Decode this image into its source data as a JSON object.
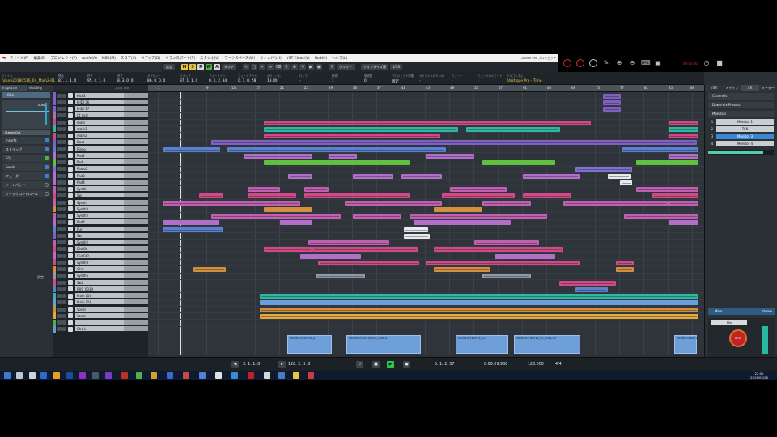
{
  "app": {
    "window_title": "Cubase Pro プロジェクト - future20180526"
  },
  "menu": [
    "ファイル(F)",
    "編集(E)",
    "プロジェクト(P)",
    "Audio(A)",
    "MIDI(M)",
    "スコア(S)",
    "メディア(D)",
    "トランスポート(T)",
    "スタジオ(U)",
    "ワークスペース(W)",
    "ウィンドウ(I)",
    "VST Cloud(V)",
    "Hub(H)",
    "ヘルプ(L)"
  ],
  "toolbar": {
    "setting_label": "設定",
    "m": "M",
    "s": "S",
    "r": "R",
    "w": "W",
    "a": "A",
    "touch_label": "タッチ",
    "grid_label": "グリッド",
    "quantize_mode": "クオンタイズ値",
    "quantize_value": "1/16"
  },
  "recorder": {
    "time": "00:00:00"
  },
  "infoline": {
    "fields": [
      {
        "label": "ファイル",
        "value": "future20180516_04_Main2-01",
        "highlight": true
      },
      {
        "label": "開始",
        "value": "87. 1. 1. 0"
      },
      {
        "label": "終了",
        "value": "95. 4. 1. 0"
      },
      {
        "label": "長さ",
        "value": "8. 3. 0. 0"
      },
      {
        "label": "オフセット",
        "value": "86. 0. 0. 0"
      },
      {
        "label": "スナップ",
        "value": "87. 1. 1. 0"
      },
      {
        "label": "フェードイン",
        "value": "0. 1. 2. 34"
      },
      {
        "label": "フェードアウト",
        "value": "0. 1. 0. 58"
      },
      {
        "label": "ボリューム",
        "value": "13.80"
      },
      {
        "label": "ロック",
        "value": "-"
      },
      {
        "label": "移調",
        "value": "1"
      },
      {
        "label": "微調整",
        "value": "0"
      },
      {
        "label": "プロジェクト同期",
        "value": "固定"
      },
      {
        "label": "オリジナルのテンポ",
        "value": "-"
      },
      {
        "label": "ミュート",
        "value": "-"
      },
      {
        "label": "ミュージカルモード",
        "value": "-"
      },
      {
        "label": "アルゴリズム",
        "value": "élastique Pro - Time",
        "highlight": true
      }
    ]
  },
  "inspector": {
    "tabs": [
      "Inspector",
      "Visibility"
    ],
    "track_name": "Cho",
    "output": "Stereo Out",
    "fader_value": "0.00",
    "sections": [
      {
        "label": "Inserts",
        "icon": "blue"
      },
      {
        "label": "ストリップ",
        "icon": "blue"
      },
      {
        "label": "EQ",
        "icon": "green"
      },
      {
        "label": "Sends",
        "icon": "blue"
      },
      {
        "label": "フェーダー",
        "icon": "blue"
      },
      {
        "label": "ノートパッド",
        "icon": "none"
      },
      {
        "label": "クイックコントロール",
        "icon": "none"
      }
    ],
    "setting_label": "設定",
    "bottom_tabs": [
      "トラック",
      "エディター"
    ]
  },
  "tracklist": {
    "header_numbers": "100 | 150",
    "tracks": [
      {
        "name": "Kick2",
        "color": "#8060c0"
      },
      {
        "name": "MIDI 36",
        "color": "#8060c0"
      },
      {
        "name": "MIDI 37",
        "color": "#8060c0"
      },
      {
        "name": "Ct noiz",
        "color": "#b070b0"
      },
      {
        "name": "main",
        "color": "#d04a88"
      },
      {
        "name": "main3",
        "color": "#30b8a0"
      },
      {
        "name": "main2",
        "color": "#d04a88"
      },
      {
        "name": "Bass",
        "color": "#8060c0"
      },
      {
        "name": "Piano",
        "color": "#5a80d0"
      },
      {
        "name": "Pad2",
        "color": "#b070c8"
      },
      {
        "name": "Pad",
        "color": "#60c040"
      },
      {
        "name": "Piano2",
        "color": "#8070d0"
      },
      {
        "name": "Pad3",
        "color": "#b070c8"
      },
      {
        "name": "Pad4",
        "color": "#b070c8"
      },
      {
        "name": "Synth",
        "color": "#c060b0"
      },
      {
        "name": "Sw",
        "color": "#d04a88"
      },
      {
        "name": "Synth",
        "color": "#c060b0"
      },
      {
        "name": "Synth3",
        "color": "#d09040"
      },
      {
        "name": "Synth2",
        "color": "#c060b0"
      },
      {
        "name": "Pad4",
        "color": "#b070c8"
      },
      {
        "name": "Pur",
        "color": "#5a80d0"
      },
      {
        "name": "Sw",
        "color": "#8060c0"
      },
      {
        "name": "Synth2",
        "color": "#c060b0"
      },
      {
        "name": "DistGt",
        "color": "#d04a88"
      },
      {
        "name": "DistGt2",
        "color": "#b070c8"
      },
      {
        "name": "Synth3",
        "color": "#d04a88"
      },
      {
        "name": "Ohit",
        "color": "#d09040"
      },
      {
        "name": "Synth5",
        "color": "#8e9aa6"
      },
      {
        "name": "Sw2",
        "color": "#d04a88"
      },
      {
        "name": "R09_0034",
        "color": "#5a80d0"
      },
      {
        "name": "Main (D)",
        "color": "#30b8a0"
      },
      {
        "name": "Main (D)",
        "color": "#6aa0e0"
      },
      {
        "name": "Vocal",
        "color": "#d09040"
      },
      {
        "name": "Vocal",
        "color": "#e4a840"
      },
      {
        "name": "",
        "color": "#4fb04f"
      },
      {
        "name": "Cho L",
        "color": "#6a9ad0"
      }
    ]
  },
  "ruler": {
    "bars": [
      "1",
      "9",
      "13",
      "17",
      "21",
      "25",
      "29",
      "33",
      "37",
      "41",
      "45",
      "49",
      "53",
      "57",
      "61",
      "65",
      "69",
      "73",
      "77",
      "81",
      "85",
      "89"
    ]
  },
  "audio_clips": [
    {
      "label": "future20180516_0"
    },
    {
      "label": "future20180516_02_ChoL-01"
    },
    {
      "label": "future20180516_02"
    },
    {
      "label": "future20180516_02_ChoL-03"
    },
    {
      "label": "future20180516"
    }
  ],
  "rightzone": {
    "tabs": [
      "VSTi",
      "メディア",
      "CR",
      "メーター"
    ],
    "sections": [
      "Channels",
      "Downmix Presets",
      "Monitors"
    ],
    "monitors": [
      {
        "num": "1",
        "name": "Monitor 1"
      },
      {
        "num": "2",
        "name": "TSK"
      },
      {
        "num": "3",
        "name": "Monitor 3",
        "active": true
      },
      {
        "num": "4",
        "name": "Monitor 4"
      }
    ],
    "main_label": "Main",
    "main_config": "stereo",
    "ctrl_name": "Mix",
    "knob_value": "0.00",
    "bottom_tabs": [
      "構成",
      "Inserts"
    ]
  },
  "transport": {
    "left_locator": "3. 1. 1. 0",
    "right_locator": "128. 2. 3. 0",
    "position_bars": "5. 1. 2. 57",
    "position_time": "0:00:09.936",
    "tempo": "123.000",
    "signature": "4/4"
  },
  "clock": {
    "time": "22:00",
    "date": "2019/05/26"
  }
}
